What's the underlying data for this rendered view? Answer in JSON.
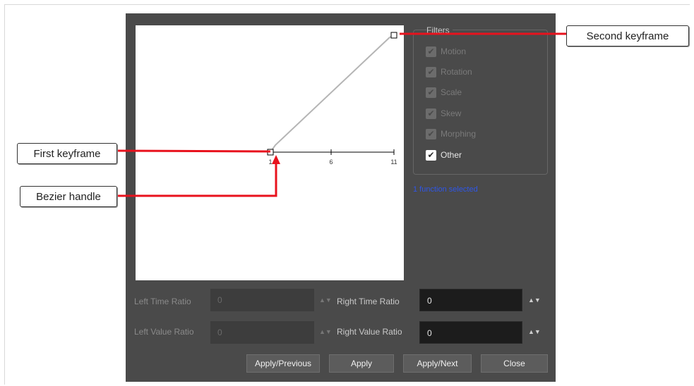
{
  "graph": {
    "ticks": [
      "1",
      "6",
      "11"
    ]
  },
  "filters": {
    "title": "Filters",
    "items": [
      {
        "label": "Motion",
        "checked": true,
        "enabled": false
      },
      {
        "label": "Rotation",
        "checked": true,
        "enabled": false
      },
      {
        "label": "Scale",
        "checked": true,
        "enabled": false
      },
      {
        "label": "Skew",
        "checked": true,
        "enabled": false
      },
      {
        "label": "Morphing",
        "checked": true,
        "enabled": false
      },
      {
        "label": "Other",
        "checked": true,
        "enabled": true
      }
    ]
  },
  "status": {
    "selected": "1 function selected"
  },
  "fields": {
    "left_time": {
      "label": "Left Time Ratio",
      "value": "0"
    },
    "right_time": {
      "label": "Right Time Ratio",
      "value": "0"
    },
    "left_value": {
      "label": "Left Value Ratio",
      "value": "0"
    },
    "right_value": {
      "label": "Right Value Ratio",
      "value": "0"
    }
  },
  "buttons": {
    "apply_previous": "Apply/Previous",
    "apply": "Apply",
    "apply_next": "Apply/Next",
    "close": "Close"
  },
  "callouts": {
    "second_keyframe": "Second keyframe",
    "first_keyframe": "First keyframe",
    "bezier_handle": "Bezier handle"
  },
  "colors": {
    "dialog_bg": "#4a4a4a",
    "callout_line": "#e8121d",
    "selected_text": "#2f56e6"
  }
}
